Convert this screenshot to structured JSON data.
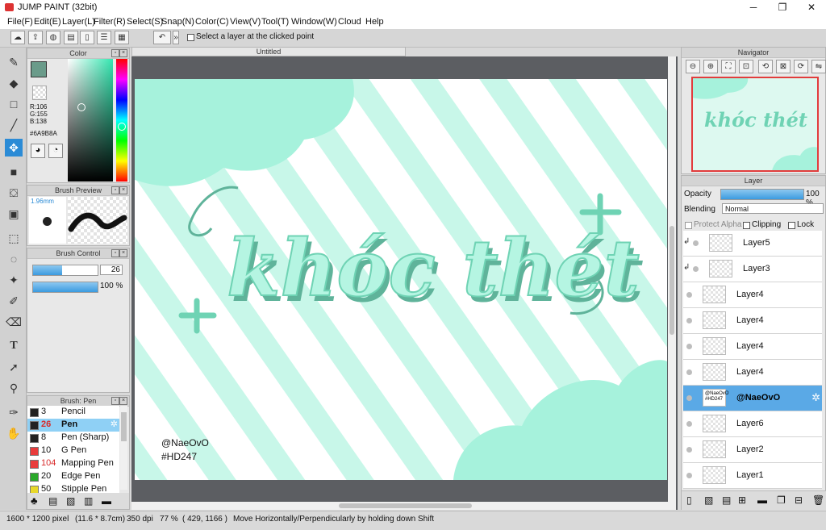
{
  "app": {
    "title": "JUMP PAINT (32bit)"
  },
  "menu": [
    "File(F)",
    "Edit(E)",
    "Layer(L)",
    "Filter(R)",
    "Select(S)",
    "Snap(N)",
    "Color(C)",
    "View(V)",
    "Tool(T)",
    "Window(W)",
    "Cloud",
    "Help"
  ],
  "toolbar": {
    "select_layer_label": "Select a layer at the clicked point"
  },
  "color_panel": {
    "title": "Color",
    "r": "R:106",
    "g": "G:155",
    "b": "B:138",
    "hex": "#6A9B8A",
    "colors": {
      "fore": "#6A9B8A",
      "accent": "#2b8bd6"
    }
  },
  "brush_preview": {
    "title": "Brush Preview",
    "size": "1.96mm"
  },
  "brush_control": {
    "title": "Brush Control",
    "size_value": "26",
    "opacity_value": "100 %",
    "size_fill": 0.45,
    "opacity_fill": 1.0
  },
  "brush_list": {
    "title": "Brush: Pen",
    "items": [
      {
        "size": "3",
        "name": "Pencil",
        "swatch": "#222222"
      },
      {
        "size": "26",
        "name": "Pen",
        "swatch": "#222222",
        "selected": true
      },
      {
        "size": "8",
        "name": "Pen (Sharp)",
        "swatch": "#222222"
      },
      {
        "size": "10",
        "name": "G Pen",
        "swatch": "#e83c3c"
      },
      {
        "size": "104",
        "name": "Mapping Pen",
        "swatch": "#e83c3c"
      },
      {
        "size": "20",
        "name": "Edge Pen",
        "swatch": "#2aa82a"
      },
      {
        "size": "50",
        "name": "Stipple Pen",
        "swatch": "#e8d82a"
      }
    ]
  },
  "document": {
    "tab": "Untitled",
    "art_text": "khóc thét",
    "credit_1": "@NaeOvO",
    "credit_2": "#HD247",
    "colors": {
      "mint": "#a6f2dc",
      "dark_mint": "#5fb39a",
      "work": "#5c5e62"
    }
  },
  "navigator": {
    "title": "Navigator",
    "thumb_text": "khóc thét"
  },
  "layer_panel": {
    "title": "Layer",
    "opacity_label": "Opacity",
    "opacity_value": "100 %",
    "opacity_fill": 1.0,
    "blending_label": "Blending",
    "blending_value": "Normal",
    "protect_alpha": "Protect Alpha",
    "clipping": "Clipping",
    "lock": "Lock",
    "layers": [
      {
        "name": "Layer5",
        "clip": true
      },
      {
        "name": "Layer3",
        "clip": true
      },
      {
        "name": "Layer4"
      },
      {
        "name": "Layer4"
      },
      {
        "name": "Layer4"
      },
      {
        "name": "Layer4"
      },
      {
        "name": "@NaeOvO",
        "selected": true,
        "thumb_text": "@NaeOvO #HD247"
      },
      {
        "name": "Layer6"
      },
      {
        "name": "Layer2"
      },
      {
        "name": "Layer1"
      }
    ]
  },
  "status": {
    "pixels": "1600 * 1200 pixel",
    "physical": "(11.6 * 8.7cm)",
    "dpi": "350 dpi",
    "zoom": "77 %",
    "coords": "( 429, 1166 )",
    "hint": "Move Horizontally/Perpendicularly by holding down Shift"
  }
}
